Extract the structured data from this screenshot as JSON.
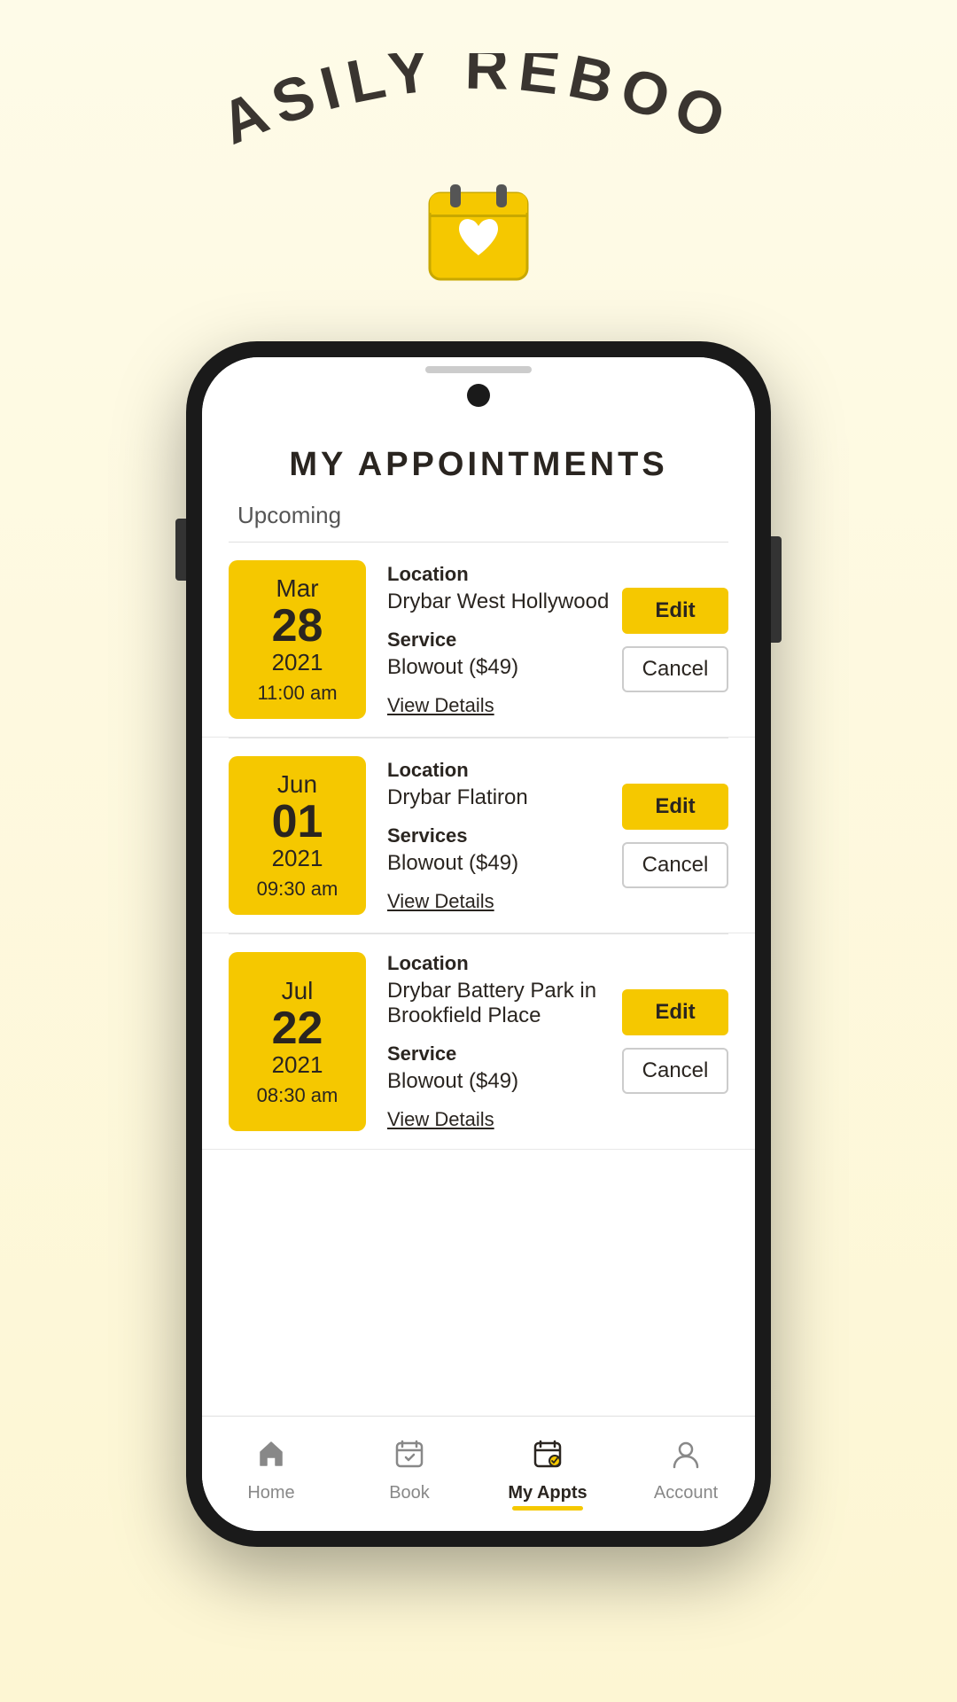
{
  "hero": {
    "title": "EASILY REBOOK"
  },
  "app": {
    "page_title": "MY APPOINTMENTS",
    "section_label": "Upcoming"
  },
  "appointments": [
    {
      "id": 1,
      "month": "Mar",
      "day": "28",
      "year": "2021",
      "time": "11:00 am",
      "location_label": "Location",
      "location": "Drybar West Hollywood",
      "service_label": "Service",
      "service": "Blowout ($49)",
      "edit_label": "Edit",
      "cancel_label": "Cancel",
      "view_details_label": "View Details"
    },
    {
      "id": 2,
      "month": "Jun",
      "day": "01",
      "year": "2021",
      "time": "09:30 am",
      "location_label": "Location",
      "location": "Drybar Flatiron",
      "service_label": "Services",
      "service": "Blowout ($49)",
      "edit_label": "Edit",
      "cancel_label": "Cancel",
      "view_details_label": "View Details"
    },
    {
      "id": 3,
      "month": "Jul",
      "day": "22",
      "year": "2021",
      "time": "08:30 am",
      "location_label": "Location",
      "location": "Drybar Battery Park in Brookfield Place",
      "service_label": "Service",
      "service": "Blowout ($49)",
      "edit_label": "Edit",
      "cancel_label": "Cancel",
      "view_details_label": "View Details"
    }
  ],
  "nav": {
    "items": [
      {
        "id": "home",
        "label": "Home",
        "icon": "🏠",
        "active": false
      },
      {
        "id": "book",
        "label": "Book",
        "icon": "📅",
        "active": false
      },
      {
        "id": "my-appts",
        "label": "My Appts",
        "icon": "🗓",
        "active": true
      },
      {
        "id": "account",
        "label": "Account",
        "icon": "👤",
        "active": false
      }
    ]
  },
  "colors": {
    "yellow": "#f5c800",
    "dark": "#2a2520",
    "white": "#ffffff"
  }
}
